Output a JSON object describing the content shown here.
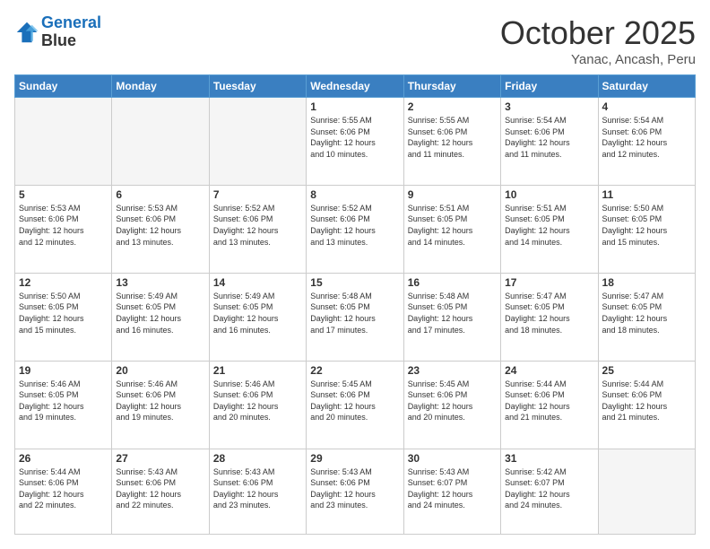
{
  "header": {
    "logo_line1": "General",
    "logo_line2": "Blue",
    "month": "October 2025",
    "location": "Yanac, Ancash, Peru"
  },
  "weekdays": [
    "Sunday",
    "Monday",
    "Tuesday",
    "Wednesday",
    "Thursday",
    "Friday",
    "Saturday"
  ],
  "weeks": [
    [
      {
        "day": "",
        "info": ""
      },
      {
        "day": "",
        "info": ""
      },
      {
        "day": "",
        "info": ""
      },
      {
        "day": "1",
        "info": "Sunrise: 5:55 AM\nSunset: 6:06 PM\nDaylight: 12 hours\nand 10 minutes."
      },
      {
        "day": "2",
        "info": "Sunrise: 5:55 AM\nSunset: 6:06 PM\nDaylight: 12 hours\nand 11 minutes."
      },
      {
        "day": "3",
        "info": "Sunrise: 5:54 AM\nSunset: 6:06 PM\nDaylight: 12 hours\nand 11 minutes."
      },
      {
        "day": "4",
        "info": "Sunrise: 5:54 AM\nSunset: 6:06 PM\nDaylight: 12 hours\nand 12 minutes."
      }
    ],
    [
      {
        "day": "5",
        "info": "Sunrise: 5:53 AM\nSunset: 6:06 PM\nDaylight: 12 hours\nand 12 minutes."
      },
      {
        "day": "6",
        "info": "Sunrise: 5:53 AM\nSunset: 6:06 PM\nDaylight: 12 hours\nand 13 minutes."
      },
      {
        "day": "7",
        "info": "Sunrise: 5:52 AM\nSunset: 6:06 PM\nDaylight: 12 hours\nand 13 minutes."
      },
      {
        "day": "8",
        "info": "Sunrise: 5:52 AM\nSunset: 6:06 PM\nDaylight: 12 hours\nand 13 minutes."
      },
      {
        "day": "9",
        "info": "Sunrise: 5:51 AM\nSunset: 6:05 PM\nDaylight: 12 hours\nand 14 minutes."
      },
      {
        "day": "10",
        "info": "Sunrise: 5:51 AM\nSunset: 6:05 PM\nDaylight: 12 hours\nand 14 minutes."
      },
      {
        "day": "11",
        "info": "Sunrise: 5:50 AM\nSunset: 6:05 PM\nDaylight: 12 hours\nand 15 minutes."
      }
    ],
    [
      {
        "day": "12",
        "info": "Sunrise: 5:50 AM\nSunset: 6:05 PM\nDaylight: 12 hours\nand 15 minutes."
      },
      {
        "day": "13",
        "info": "Sunrise: 5:49 AM\nSunset: 6:05 PM\nDaylight: 12 hours\nand 16 minutes."
      },
      {
        "day": "14",
        "info": "Sunrise: 5:49 AM\nSunset: 6:05 PM\nDaylight: 12 hours\nand 16 minutes."
      },
      {
        "day": "15",
        "info": "Sunrise: 5:48 AM\nSunset: 6:05 PM\nDaylight: 12 hours\nand 17 minutes."
      },
      {
        "day": "16",
        "info": "Sunrise: 5:48 AM\nSunset: 6:05 PM\nDaylight: 12 hours\nand 17 minutes."
      },
      {
        "day": "17",
        "info": "Sunrise: 5:47 AM\nSunset: 6:05 PM\nDaylight: 12 hours\nand 18 minutes."
      },
      {
        "day": "18",
        "info": "Sunrise: 5:47 AM\nSunset: 6:05 PM\nDaylight: 12 hours\nand 18 minutes."
      }
    ],
    [
      {
        "day": "19",
        "info": "Sunrise: 5:46 AM\nSunset: 6:05 PM\nDaylight: 12 hours\nand 19 minutes."
      },
      {
        "day": "20",
        "info": "Sunrise: 5:46 AM\nSunset: 6:06 PM\nDaylight: 12 hours\nand 19 minutes."
      },
      {
        "day": "21",
        "info": "Sunrise: 5:46 AM\nSunset: 6:06 PM\nDaylight: 12 hours\nand 20 minutes."
      },
      {
        "day": "22",
        "info": "Sunrise: 5:45 AM\nSunset: 6:06 PM\nDaylight: 12 hours\nand 20 minutes."
      },
      {
        "day": "23",
        "info": "Sunrise: 5:45 AM\nSunset: 6:06 PM\nDaylight: 12 hours\nand 20 minutes."
      },
      {
        "day": "24",
        "info": "Sunrise: 5:44 AM\nSunset: 6:06 PM\nDaylight: 12 hours\nand 21 minutes."
      },
      {
        "day": "25",
        "info": "Sunrise: 5:44 AM\nSunset: 6:06 PM\nDaylight: 12 hours\nand 21 minutes."
      }
    ],
    [
      {
        "day": "26",
        "info": "Sunrise: 5:44 AM\nSunset: 6:06 PM\nDaylight: 12 hours\nand 22 minutes."
      },
      {
        "day": "27",
        "info": "Sunrise: 5:43 AM\nSunset: 6:06 PM\nDaylight: 12 hours\nand 22 minutes."
      },
      {
        "day": "28",
        "info": "Sunrise: 5:43 AM\nSunset: 6:06 PM\nDaylight: 12 hours\nand 23 minutes."
      },
      {
        "day": "29",
        "info": "Sunrise: 5:43 AM\nSunset: 6:06 PM\nDaylight: 12 hours\nand 23 minutes."
      },
      {
        "day": "30",
        "info": "Sunrise: 5:43 AM\nSunset: 6:07 PM\nDaylight: 12 hours\nand 24 minutes."
      },
      {
        "day": "31",
        "info": "Sunrise: 5:42 AM\nSunset: 6:07 PM\nDaylight: 12 hours\nand 24 minutes."
      },
      {
        "day": "",
        "info": ""
      }
    ]
  ]
}
